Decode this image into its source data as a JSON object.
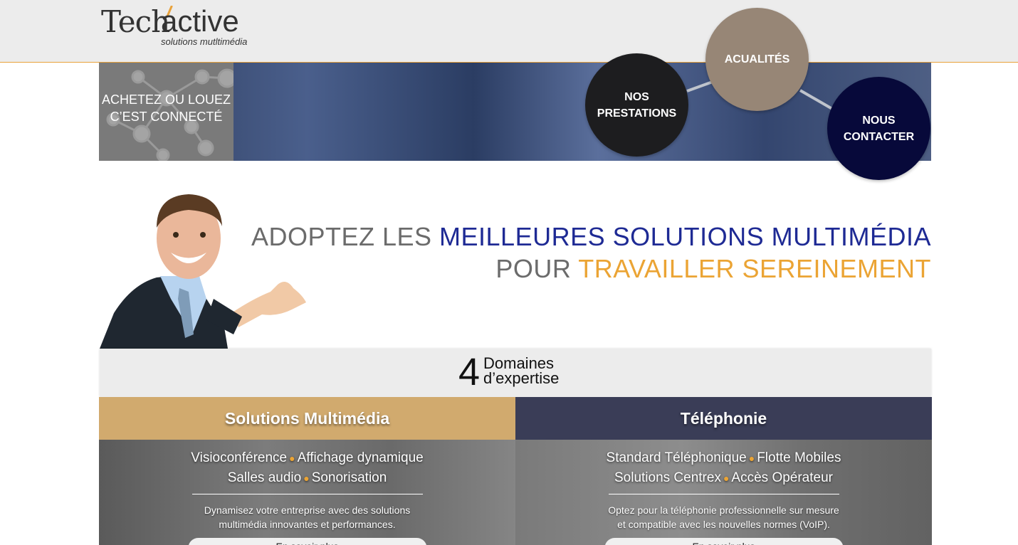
{
  "logo": {
    "brand_part1": "Tech",
    "brand_part2": "active",
    "tagline": "solutions mutltimédia"
  },
  "banner": {
    "line1": "ACHETEZ OU LOUEZ",
    "line2": "C’EST CONNECTÉ"
  },
  "nav": {
    "prestations": {
      "line1": "NOS",
      "line2": "PRESTATIONS"
    },
    "actualites": "ACUALITÉS",
    "contact": {
      "line1": "NOUS",
      "line2": "CONTACTER"
    }
  },
  "headline": {
    "part1": "ADOPTEZ LES ",
    "part2": "MEILLEURES SOLUTIONS MULTIMÉDIA",
    "part3": "POUR ",
    "part4": "TRAVAILLER SEREINEMENT"
  },
  "domains": {
    "number": "4",
    "line1": "Domaines",
    "line2": "d’expertise"
  },
  "cards": [
    {
      "title": "Solutions Multimédia",
      "services_line1": [
        "Visioconférence",
        "Affichage dynamique"
      ],
      "services_line2": [
        "Salles audio",
        "Sonorisation"
      ],
      "desc_line1": "Dynamisez votre entreprise avec des solutions",
      "desc_line2": "multimédia innovantes et performances.",
      "button": "En savoir plus"
    },
    {
      "title": "Téléphonie",
      "services_line1": [
        "Standard Téléphonique",
        "Flotte Mobiles"
      ],
      "services_line2": [
        "Solutions Centrex",
        "Accès Opérateur"
      ],
      "desc_line1": "Optez pour la téléphonie professionnelle sur mesure",
      "desc_line2": "et compatible avec les nouvelles normes (VoIP).",
      "button": "En savoir plus"
    }
  ],
  "colors": {
    "accent_orange": "#eba434",
    "navy": "#07093a",
    "headline_blue": "#1e2a94",
    "taupe": "#978676"
  }
}
